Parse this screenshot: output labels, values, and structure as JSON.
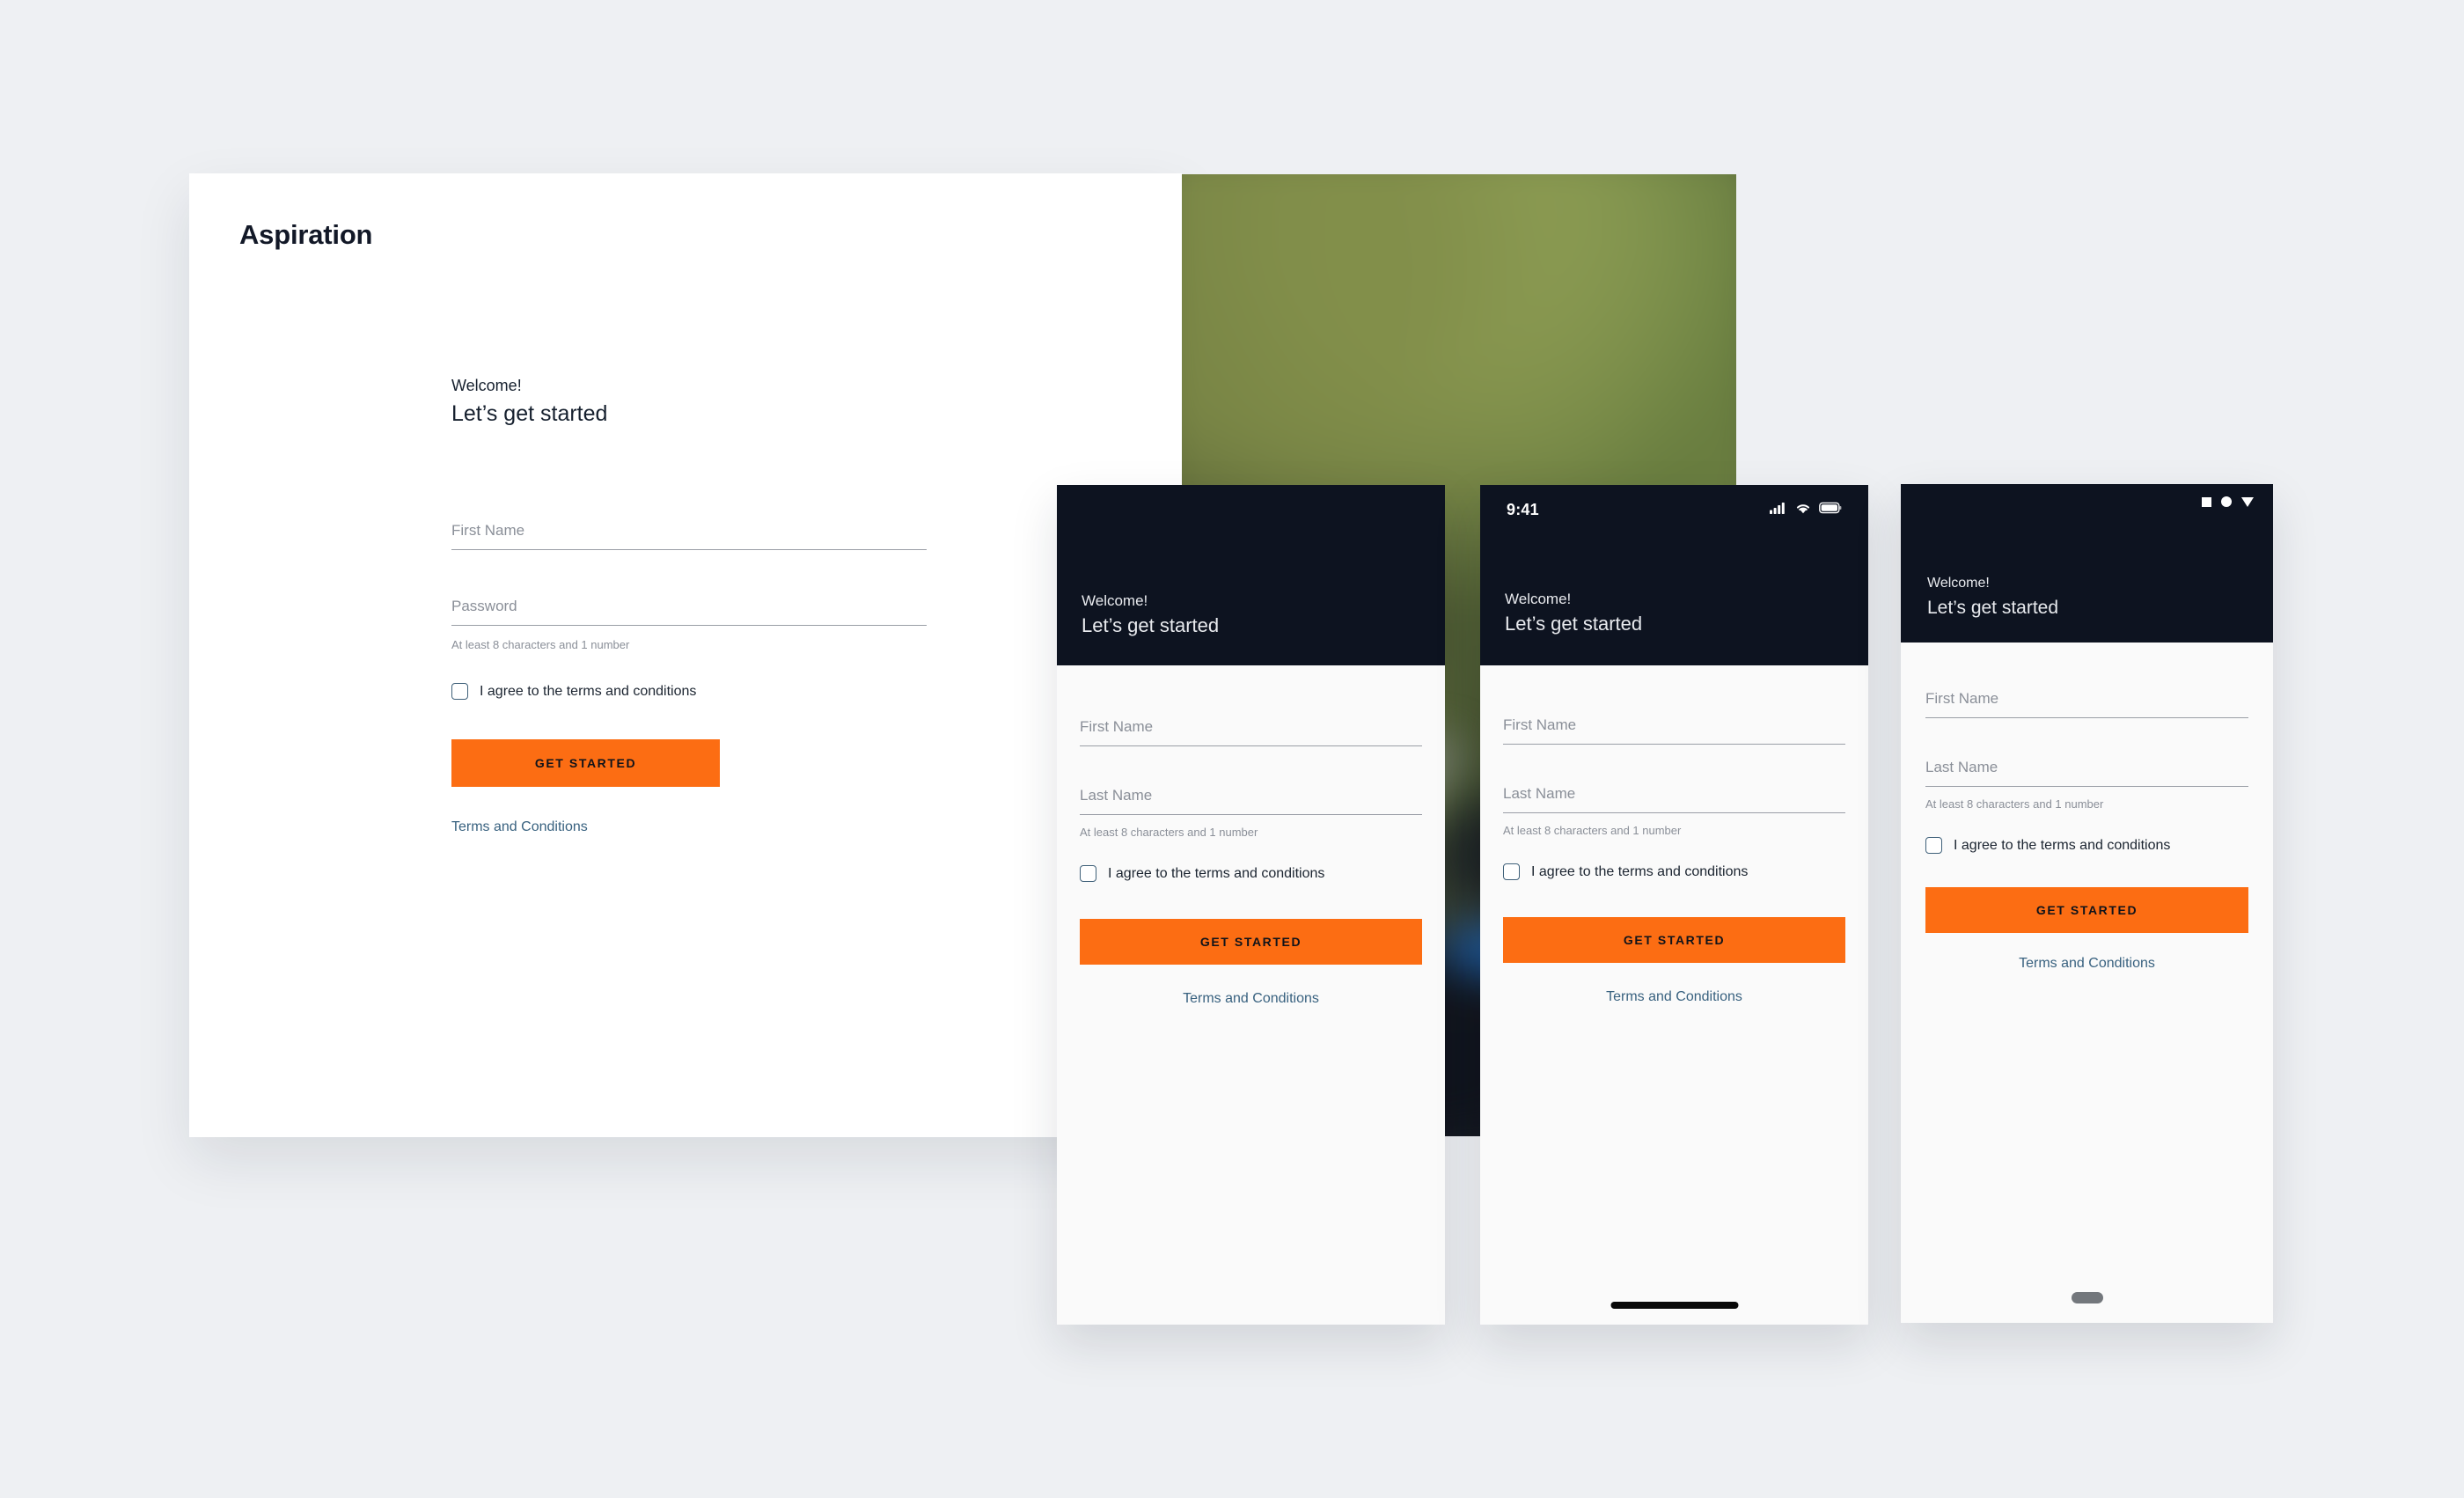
{
  "theme": {
    "page_background": "#eef0f3",
    "accent_orange": "#fc6d13",
    "dark_header": "#0d1320",
    "link_blue": "#38617f",
    "panel_white": "#ffffff",
    "panel_offwhite": "#fafafa"
  },
  "desktop": {
    "brand": "Aspiration",
    "welcome_small": "Welcome!",
    "welcome_big": "Let’s get started",
    "fields": [
      {
        "label": "First Name",
        "value": ""
      },
      {
        "label": "Password",
        "value": ""
      }
    ],
    "helper_text": "At least 8 characters and 1 number",
    "checkbox_label": "I agree to the terms and conditions",
    "checkbox_checked": false,
    "cta_label": "GET STARTED",
    "terms_link": "Terms and Conditions"
  },
  "mobile_plain": {
    "welcome_small": "Welcome!",
    "welcome_big": "Let’s get started",
    "fields": [
      {
        "label": "First Name",
        "value": ""
      },
      {
        "label": "Last Name",
        "value": ""
      }
    ],
    "helper_text": "At least 8 characters and 1 number",
    "checkbox_label": "I agree to the terms and conditions",
    "checkbox_checked": false,
    "cta_label": "GET STARTED",
    "terms_link": "Terms and Conditions"
  },
  "mobile_ios": {
    "status_bar": {
      "time": "9:41",
      "icons": [
        "cellular-signal-icon",
        "wifi-icon",
        "battery-icon"
      ]
    },
    "welcome_small": "Welcome!",
    "welcome_big": "Let’s get started",
    "fields": [
      {
        "label": "First Name",
        "value": ""
      },
      {
        "label": "Last Name",
        "value": ""
      }
    ],
    "helper_text": "At least 8 characters and 1 number",
    "checkbox_label": "I agree to the terms and conditions",
    "checkbox_checked": false,
    "cta_label": "GET STARTED",
    "terms_link": "Terms and Conditions",
    "home_indicator": "home-indicator"
  },
  "mobile_android": {
    "status_bar": {
      "icons": [
        "square-icon",
        "circle-icon",
        "triangle-down-icon"
      ]
    },
    "welcome_small": "Welcome!",
    "welcome_big": "Let’s get started",
    "fields": [
      {
        "label": "First Name",
        "value": ""
      },
      {
        "label": "Last Name",
        "value": ""
      }
    ],
    "helper_text": "At least 8 characters and 1 number",
    "checkbox_label": "I agree to the terms and conditions",
    "checkbox_checked": false,
    "cta_label": "GET STARTED",
    "terms_link": "Terms and Conditions",
    "home_pill": "home-pill"
  },
  "background_photo": {
    "description": "blurred dark forest foliage photograph"
  }
}
